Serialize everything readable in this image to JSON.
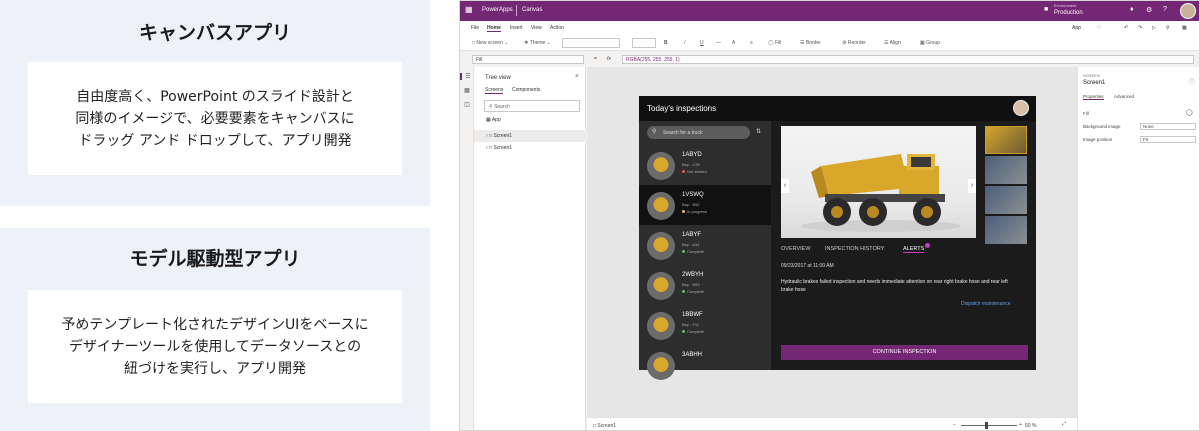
{
  "left": {
    "canvas": {
      "title": "キャンバスアプリ",
      "lines": [
        "自由度高く、PowerPoint のスライド設計と",
        "同様のイメージで、必要要素をキャンバスに",
        "ドラッグ アンド ドロップして、アプリ開発"
      ]
    },
    "model": {
      "title": "モデル駆動型アプリ",
      "lines": [
        "予めテンプレート化されたデザインUIをベースに",
        "デザイナーツールを使用してデータソースとの",
        "紐づけを実行し、アプリ開発"
      ]
    }
  },
  "titlebar": {
    "app_name": "PowerApps",
    "section": "Canvas",
    "env_label": "Environment",
    "env_value": "Production"
  },
  "menu": {
    "file": "File",
    "home": "Home",
    "insert": "Insert",
    "view": "View",
    "action": "Action"
  },
  "toolbar": {
    "new_screen": "New screen",
    "theme": "Theme",
    "fill": "Fill",
    "border": "Border",
    "reorder": "Reorder",
    "align": "Align",
    "group": "Group",
    "app_label": "App"
  },
  "formula": {
    "property": "Fill",
    "eq": "=",
    "fx": "fx",
    "value": "RGBA(255, 255, 255, 1)"
  },
  "tree": {
    "title": "Tree view",
    "tab_screens": "Screens",
    "tab_components": "Components",
    "search_placeholder": "Search",
    "app": "App",
    "rows": [
      "Screen1",
      "Screen1"
    ]
  },
  "status": {
    "screen": "Screen1",
    "zoom": "50 %"
  },
  "screen": {
    "title": "Today's inspections",
    "search_placeholder": "Search for a truck",
    "items": [
      {
        "id": "1ABYD",
        "bay": "Bay - C35",
        "status": "Not started",
        "status_color": "#e05a5a"
      },
      {
        "id": "1VSWQ",
        "bay": "Bay - B52",
        "status": "In progress",
        "status_color": "#e0c15a"
      },
      {
        "id": "1ABYF",
        "bay": "Bay - A34",
        "status": "Complete",
        "status_color": "#5ac05a"
      },
      {
        "id": "2WBYH",
        "bay": "Bay - B53",
        "status": "Complete",
        "status_color": "#5ac05a"
      },
      {
        "id": "1BBWF",
        "bay": "Bay - F11",
        "status": "Complete",
        "status_color": "#5ac05a"
      },
      {
        "id": "3ABHH",
        "bay": "",
        "status": "",
        "status_color": "#5ac05a"
      }
    ],
    "tabs": {
      "overview": "OVERVIEW",
      "history": "INSPECTION HISTORY",
      "alerts": "ALERTS"
    },
    "date": "09/23/2017 at 11:00 AM",
    "alert_text": "Hydraulic brakes failed inspection and needs immediate attention on rear right brake hose and rear left brake hose",
    "dispatch": "Dispatch maintenance",
    "continue": "CONTINUE INSPECTION"
  },
  "props": {
    "section_label": "SCREEN",
    "screen_name": "Screen1",
    "tab_properties": "Properties",
    "tab_advanced": "Advanced",
    "fill_label": "Fill",
    "bg_image_label": "Background image",
    "bg_image_value": "None",
    "image_pos_label": "Image position",
    "image_pos_value": "Fit"
  },
  "colors": {
    "brand": "#742774",
    "panel_bg": "#edf1f8",
    "accent_alert": "#c23fc2",
    "link": "#5da0e0"
  }
}
